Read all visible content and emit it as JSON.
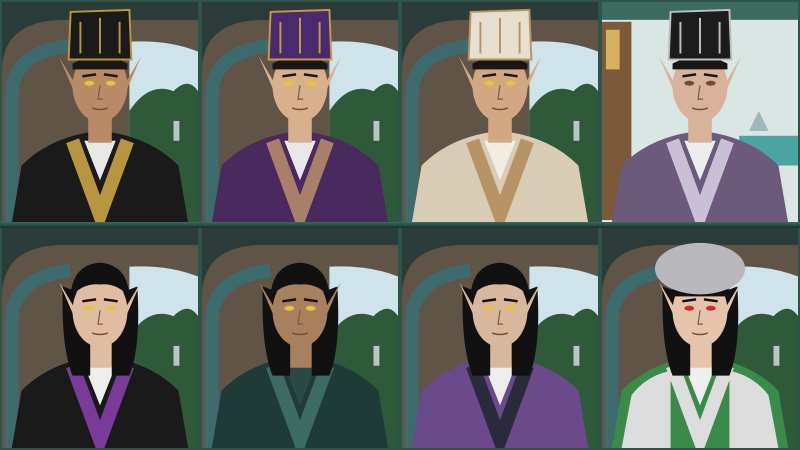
{
  "portraits": [
    {
      "id": "p1",
      "hat": "black-gold",
      "robe": "#1a1a1a",
      "trim": "#b8963f",
      "inner": "#e8e8e8",
      "skin": "#b88a66",
      "hair": "#1b1613",
      "eyes": "#e8c23a",
      "bg": "balcony"
    },
    {
      "id": "p2",
      "hat": "purple-gold",
      "robe": "#4a2a5e",
      "trim": "#a8806a",
      "inner": "#e8e8e8",
      "skin": "#d8b08c",
      "hair": "#1b1613",
      "eyes": "#e8c23a",
      "bg": "balcony"
    },
    {
      "id": "p3",
      "hat": "cream-gold",
      "robe": "#d8cdb4",
      "trim": "#b69468",
      "inner": "#f2ede2",
      "skin": "#d4a783",
      "hair": "#1b1613",
      "eyes": "#e8c23a",
      "bg": "balcony"
    },
    {
      "id": "p4",
      "hat": "black-silver",
      "robe": "#6c5a7a",
      "trim": "#c9c0d6",
      "inner": "#ededed",
      "skin": "#d8b29a",
      "hair": "#1b1613",
      "eyes": "#6b4f3a",
      "bg": "sea"
    },
    {
      "id": "p5",
      "hat": "none",
      "robe": "#1a1a1a",
      "trim": "#7a3a9a",
      "inner": "#eeeeee",
      "skin": "#e0bda0",
      "hair": "#111111",
      "eyes": "#e8c23a",
      "bg": "balcony"
    },
    {
      "id": "p6",
      "hat": "none",
      "robe": "#1f3b38",
      "trim": "#3c6c64",
      "inner": "#2b4a45",
      "skin": "#a8805e",
      "hair": "#111111",
      "eyes": "#e8c23a",
      "bg": "balcony"
    },
    {
      "id": "p7",
      "hat": "none",
      "robe": "#6a4a8a",
      "trim": "#2a2a3a",
      "inner": "#eeeeee",
      "skin": "#d8b89c",
      "hair": "#111111",
      "eyes": "#e8c23a",
      "bg": "balcony"
    },
    {
      "id": "p8",
      "hat": "fur",
      "robe": "#3a8a4a",
      "trim": "#dcdcdc",
      "inner": "#eeeeee",
      "skin": "#e6c4ac",
      "hair": "#111111",
      "eyes": "#d02a2a",
      "bg": "balcony"
    }
  ],
  "colors": {
    "frame": "#2e544a",
    "frame_highlight": "#6fae9c",
    "arch_stone": "#8a6a52",
    "arch_ring": "#3d6b6e",
    "foliage": "#2f5a3a",
    "sky": "#cfe3ea"
  }
}
